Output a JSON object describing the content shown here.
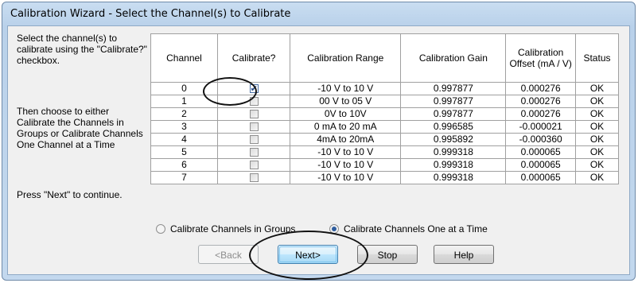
{
  "window": {
    "title": "Calibration Wizard - Select the Channel(s) to Calibrate"
  },
  "instructions": {
    "select_text": "Select the channel(s) to calibrate using the \"Calibrate?\" checkbox.",
    "choose_text": "Then choose to either Calibrate the Channels in Groups or Calibrate Channels One Channel at a Time",
    "continue_text": "Press \"Next\" to continue."
  },
  "table": {
    "headers": {
      "channel": "Channel",
      "calibrate": "Calibrate?",
      "range": "Calibration Range",
      "gain": "Calibration Gain",
      "offset": "Calibration Offset (mA / V)",
      "status": "Status"
    },
    "rows": [
      {
        "channel": "0",
        "checked": true,
        "range": "-10 V to 10 V",
        "gain": "0.997877",
        "offset": "0.000276",
        "status": "OK"
      },
      {
        "channel": "1",
        "checked": false,
        "range": "00 V to 05 V",
        "gain": "0.997877",
        "offset": "0.000276",
        "status": "OK"
      },
      {
        "channel": "2",
        "checked": false,
        "range": "0V to 10V",
        "gain": "0.997877",
        "offset": "0.000276",
        "status": "OK"
      },
      {
        "channel": "3",
        "checked": false,
        "range": "0 mA to 20 mA",
        "gain": "0.996585",
        "offset": "-0.000021",
        "status": "OK"
      },
      {
        "channel": "4",
        "checked": false,
        "range": "4mA to 20mA",
        "gain": "0.995892",
        "offset": "-0.000360",
        "status": "OK"
      },
      {
        "channel": "5",
        "checked": false,
        "range": "-10 V to 10 V",
        "gain": "0.999318",
        "offset": "0.000065",
        "status": "OK"
      },
      {
        "channel": "6",
        "checked": false,
        "range": "-10 V to 10 V",
        "gain": "0.999318",
        "offset": "0.000065",
        "status": "OK"
      },
      {
        "channel": "7",
        "checked": false,
        "range": "-10 V to 10 V",
        "gain": "0.999318",
        "offset": "0.000065",
        "status": "OK"
      }
    ]
  },
  "mode": {
    "groups_label": "Calibrate Channels in Groups",
    "one_at_a_time_label": "Calibrate Channels One at a Time",
    "selected": "one_at_a_time"
  },
  "buttons": {
    "back": "<Back",
    "next": "Next>",
    "stop": "Stop",
    "help": "Help",
    "back_enabled": false
  },
  "colors": {
    "title_gradient": "#c9ddf1",
    "default_button_border": "#3c7fb1",
    "annotation": "#111111"
  }
}
